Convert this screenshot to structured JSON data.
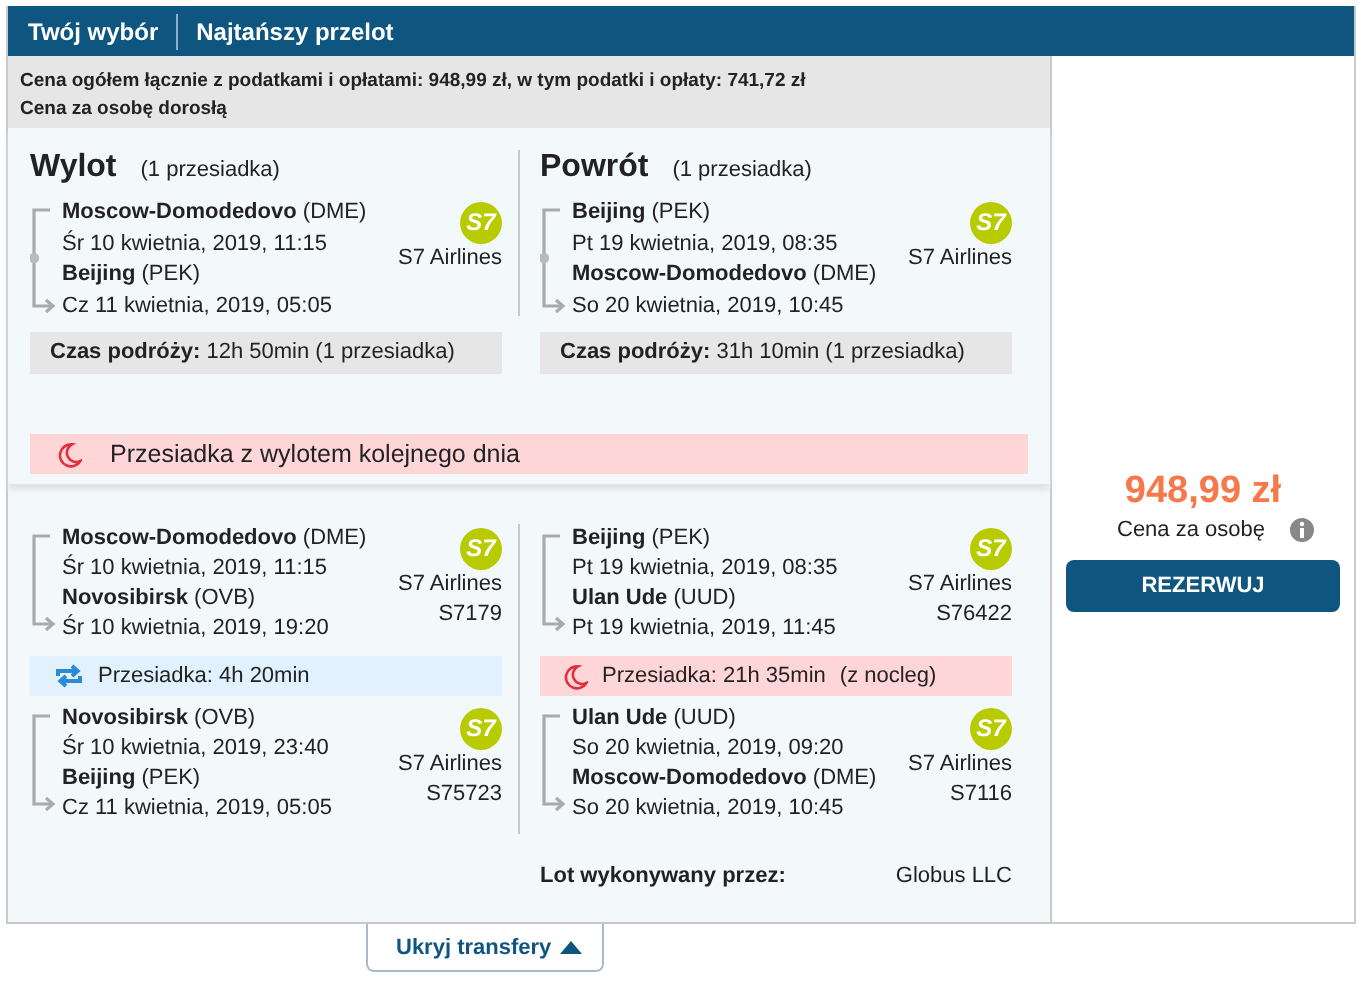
{
  "header": {
    "tabs": [
      "Twój wybór",
      "Najtańszy przelot"
    ]
  },
  "price_info": [
    "Cena ogółem łącznie z podatkami i opłatami: 948,99 zł, w tym podatki i opłaty: 741,72 zł",
    "Cena za osobę dorosłą"
  ],
  "summary": [
    {
      "title": "Wylot",
      "stops": "(1 przesiadka)",
      "from": "**Moscow-Domodedovo** (DME)",
      "from_date": "Śr 10 kwietnia, 2019, 11:15",
      "to": "**Beijing** (PEK)",
      "to_date": "Cz 11 kwietnia, 2019, 05:05",
      "logo": "S7",
      "airline": "S7 Airlines",
      "travel_time": "**Czas podróży:**  12h 50min (1 przesiadka)"
    },
    {
      "title": "Powrót",
      "stops": "(1 przesiadka)",
      "from": "**Beijing** (PEK)",
      "from_date": "Pt 19 kwietnia, 2019, 08:35",
      "to": "**Moscow-Domodedovo** (DME)",
      "to_date": "So 20 kwietnia, 2019, 10:45",
      "logo": "S7",
      "airline": "S7 Airlines",
      "travel_time": "**Czas podróży:**  31h 10min (1 przesiadka)"
    }
  ],
  "notice": "Przesiadka z wylotem kolejnego dnia",
  "details": [
    {
      "items": [
        {
          "kind": "segment",
          "from": "**Moscow-Domodedovo** (DME)",
          "from_date": "Śr 10 kwietnia, 2019, 11:15",
          "to": "**Novosibirsk** (OVB)",
          "to_date": "Śr 10 kwietnia, 2019, 19:20",
          "logo": "S7",
          "airline": "S7 Airlines",
          "flight": "S7179"
        },
        {
          "kind": "transfer",
          "overnight": false,
          "text": "Przesiadka: 4h 20min"
        },
        {
          "kind": "segment",
          "from": "**Novosibirsk** (OVB)",
          "from_date": "Śr 10 kwietnia, 2019, 23:40",
          "to": "**Beijing** (PEK)",
          "to_date": "Cz 11 kwietnia, 2019, 05:05",
          "logo": "S7",
          "airline": "S7 Airlines",
          "flight": "S75723"
        }
      ]
    },
    {
      "items": [
        {
          "kind": "segment",
          "from": "**Beijing** (PEK)",
          "from_date": "Pt 19 kwietnia, 2019, 08:35",
          "to": "**Ulan Ude** (UUD)",
          "to_date": "Pt 19 kwietnia, 2019, 11:45",
          "logo": "S7",
          "airline": "S7 Airlines",
          "flight": "S76422"
        },
        {
          "kind": "transfer",
          "overnight": true,
          "text": "Przesiadka: 21h 35min",
          "note": "(z nocleg)"
        },
        {
          "kind": "segment",
          "from": "**Ulan Ude** (UUD)",
          "from_date": "So 20 kwietnia, 2019, 09:20",
          "to": "**Moscow-Domodedovo** (DME)",
          "to_date": "So 20 kwietnia, 2019, 10:45",
          "logo": "S7",
          "airline": "S7 Airlines",
          "flight": "S7116"
        }
      ],
      "operated_by": {
        "label": "Lot wykonywany przez:",
        "value": "Globus LLC"
      }
    }
  ],
  "price": {
    "amount": "948,99 zł",
    "caption": "Cena za osobę"
  },
  "book_button": "REZERWUJ",
  "toggle": "Ukryj transfery"
}
